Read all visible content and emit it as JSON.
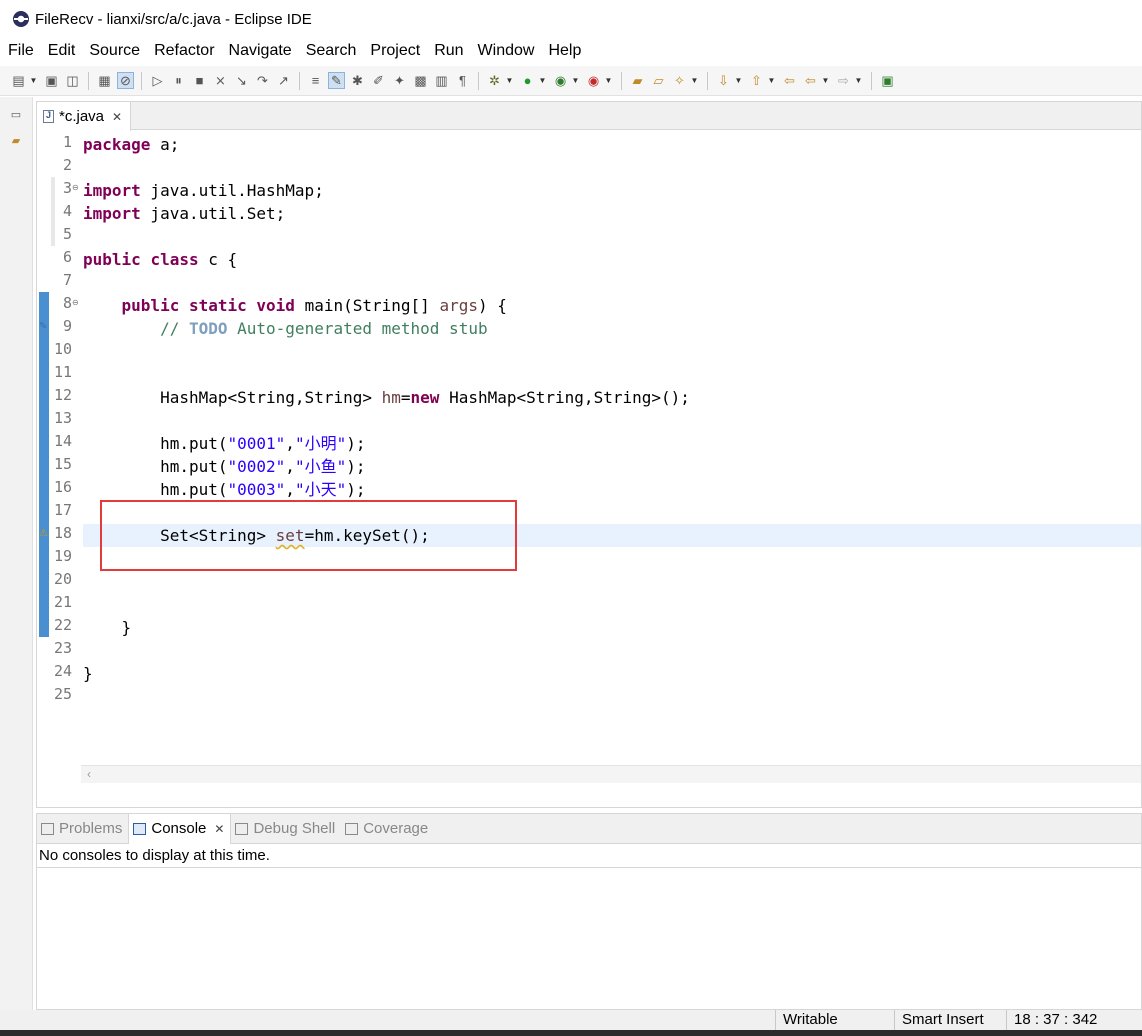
{
  "window": {
    "title": "FileRecv - lianxi/src/a/c.java - Eclipse IDE"
  },
  "menu": [
    "File",
    "Edit",
    "Source",
    "Refactor",
    "Navigate",
    "Search",
    "Project",
    "Run",
    "Window",
    "Help"
  ],
  "toolbar": {
    "icons": [
      "new-icon",
      "save-icon",
      "save-all-icon",
      "binary-icon",
      "skip-breakpoints-icon",
      "resume-icon",
      "suspend-icon",
      "terminate-icon",
      "disconnect-icon",
      "step-into-icon",
      "step-over-icon",
      "step-return-icon",
      "toggle-comment-icon",
      "mark-occurrences-icon",
      "new-java-class-icon",
      "new-package-icon",
      "open-type-icon",
      "open-task-icon",
      "block-selection-icon",
      "show-whitespace-icon",
      "debug-icon",
      "run-icon",
      "coverage-icon",
      "external-tools-icon",
      "open-folder-icon",
      "search-icon",
      "next-annotation-icon",
      "previous-annotation-icon",
      "last-edit-icon",
      "back-icon",
      "forward-icon",
      "open-perspective-icon"
    ]
  },
  "editor": {
    "tab_label": "*c.java",
    "lines": [
      {
        "n": "1"
      },
      {
        "n": "2"
      },
      {
        "n": "3"
      },
      {
        "n": "4"
      },
      {
        "n": "5"
      },
      {
        "n": "6"
      },
      {
        "n": "7"
      },
      {
        "n": "8"
      },
      {
        "n": "9"
      },
      {
        "n": "10"
      },
      {
        "n": "11"
      },
      {
        "n": "12"
      },
      {
        "n": "13"
      },
      {
        "n": "14"
      },
      {
        "n": "15"
      },
      {
        "n": "16"
      },
      {
        "n": "17"
      },
      {
        "n": "18"
      },
      {
        "n": "19"
      },
      {
        "n": "20"
      },
      {
        "n": "21"
      },
      {
        "n": "22"
      },
      {
        "n": "23"
      },
      {
        "n": "24"
      },
      {
        "n": "25"
      }
    ],
    "tokens": {
      "l1": [
        "package",
        " a;"
      ],
      "l3": [
        "import",
        " java.util.HashMap;"
      ],
      "l4": [
        "import",
        " java.util.Set;"
      ],
      "l6": [
        "public",
        " ",
        "class",
        " c {"
      ],
      "l8": [
        "    ",
        "public",
        " ",
        "static",
        " ",
        "void",
        " main(String[] ",
        "args",
        ") {"
      ],
      "l9": [
        "        // ",
        "TODO",
        " Auto-generated method stub"
      ],
      "l12": [
        "        HashMap<String,String> ",
        "hm",
        "=",
        "new",
        " HashMap<String,String>();"
      ],
      "l14": [
        "        hm.put(",
        "\"0001\"",
        ",",
        "\"小明\"",
        ");"
      ],
      "l15": [
        "        hm.put(",
        "\"0002\"",
        ",",
        "\"小鱼\"",
        ");"
      ],
      "l16": [
        "        hm.put(",
        "\"0003\"",
        ",",
        "\"小天\"",
        ");"
      ],
      "l18": [
        "        Set<String> ",
        "set",
        "=hm.keySet();"
      ],
      "l22": [
        "    }"
      ],
      "l24": [
        "}"
      ]
    }
  },
  "console": {
    "tabs": [
      "Problems",
      "Console",
      "Debug Shell",
      "Coverage"
    ],
    "message": "No consoles to display at this time."
  },
  "status": {
    "mode": "Writable",
    "insert": "Smart Insert",
    "position": "18 : 37 : 342"
  }
}
